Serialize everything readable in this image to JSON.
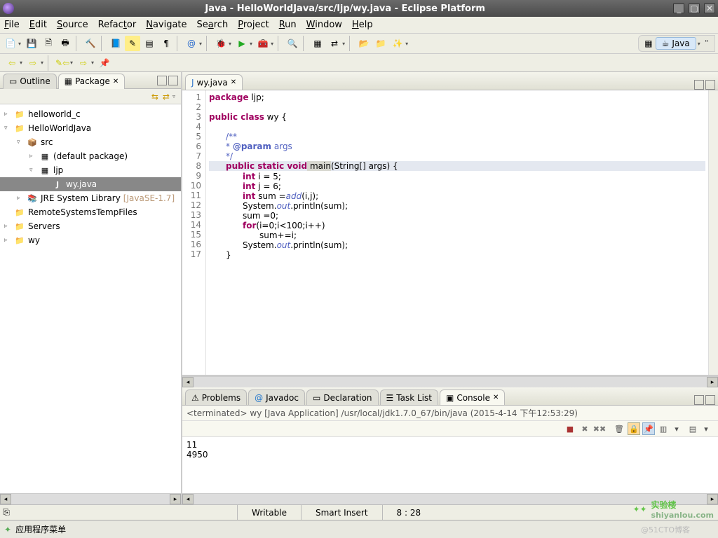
{
  "window": {
    "title": "Java - HelloWorldJava/src/ljp/wy.java - Eclipse Platform"
  },
  "menubar": [
    "File",
    "Edit",
    "Source",
    "Refactor",
    "Navigate",
    "Search",
    "Project",
    "Run",
    "Window",
    "Help"
  ],
  "perspective": {
    "label": "Java"
  },
  "left_tabs": {
    "outline": "Outline",
    "package": "Package"
  },
  "tree": {
    "items": [
      {
        "depth": 0,
        "twisty": "▹",
        "icon": "folder",
        "label": "helloworld_c"
      },
      {
        "depth": 0,
        "twisty": "▿",
        "icon": "folder",
        "label": "HelloWorldJava"
      },
      {
        "depth": 1,
        "twisty": "▿",
        "icon": "src",
        "label": "src"
      },
      {
        "depth": 2,
        "twisty": "▹",
        "icon": "pkg",
        "label": "(default package)"
      },
      {
        "depth": 2,
        "twisty": "▿",
        "icon": "pkg",
        "label": "ljp"
      },
      {
        "depth": 3,
        "twisty": "",
        "icon": "java",
        "label": "wy.java",
        "sel": true
      },
      {
        "depth": 1,
        "twisty": "▹",
        "icon": "lib",
        "label": "JRE System Library",
        "extra": "[JavaSE-1.7]"
      },
      {
        "depth": 0,
        "twisty": "",
        "icon": "folder",
        "label": "RemoteSystemsTempFiles"
      },
      {
        "depth": 0,
        "twisty": "▹",
        "icon": "folder",
        "label": "Servers"
      },
      {
        "depth": 0,
        "twisty": "▹",
        "icon": "folder",
        "label": "wy"
      }
    ]
  },
  "editor": {
    "tab": "wy.java",
    "lines_count": 17,
    "code": {
      "l1_pkg": "package",
      "l1_name": " ljp;",
      "l3_a": "public class",
      "l3_b": " wy {",
      "l5": "/**",
      "l6a": " * ",
      "l6b": "@param",
      "l6c": " args",
      "l7": " */",
      "l8a": "public static void",
      "l8b": " main",
      "l8c": "(String[] args) {",
      "l9a": "int",
      "l9b": " i = 5;",
      "l10a": "int",
      "l10b": " j = 6;",
      "l11a": "int",
      "l11b": " sum =",
      "l11c": "add",
      "l11d": "(i,j);",
      "l12a": "System.",
      "l12b": "out",
      "l12c": ".println(sum);",
      "l13": "sum =0;",
      "l14a": "for",
      "l14b": "(i=0;i<100;i++)",
      "l15": "sum+=i;",
      "l16a": "System.",
      "l16b": "out",
      "l16c": ".println(sum);",
      "l17": "}"
    }
  },
  "bottom_tabs": [
    "Problems",
    "Javadoc",
    "Declaration",
    "Task List",
    "Console"
  ],
  "console": {
    "header": "<terminated> wy [Java Application] /usr/local/jdk1.7.0_67/bin/java (2015-4-14 下午12:53:29)",
    "out1": "11",
    "out2": "4950"
  },
  "status": {
    "writable": "Writable",
    "insert": "Smart Insert",
    "pos": "8 : 28"
  },
  "taskbar": {
    "apps": "应用程序菜单"
  },
  "brand": {
    "name": "实验楼",
    "url": "shiyanlou.com"
  },
  "watermark": "@51CTO博客"
}
